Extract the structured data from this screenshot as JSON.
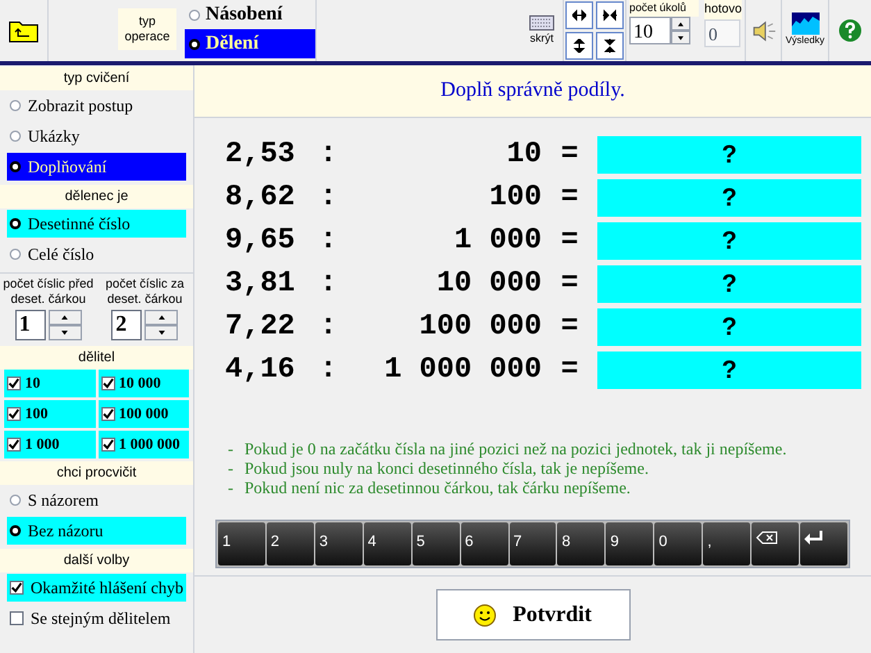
{
  "toolbar": {
    "operation_label": "typ operace",
    "operations": [
      {
        "label": "Násobení",
        "selected": false
      },
      {
        "label": "Dělení",
        "selected": true
      }
    ],
    "keyboard_label": "skrýt",
    "task_count": {
      "label": "počet úkolů",
      "value": "10"
    },
    "done": {
      "label": "hotovo",
      "value": "0",
      "disabled": true
    },
    "results_label": "Výsledky"
  },
  "sidebar": [
    {
      "title": "typ cvičení",
      "kind": "mode",
      "options": [
        {
          "label": "Zobrazit postup",
          "selected": false
        },
        {
          "label": "Ukázky",
          "selected": false
        },
        {
          "label": "Doplňování",
          "selected": true
        }
      ]
    },
    {
      "title": "dělenec je",
      "kind": "radio",
      "options": [
        {
          "label": "Desetinné číslo",
          "selected": true
        },
        {
          "label": "Celé číslo",
          "selected": false
        }
      ]
    },
    {
      "kind": "spinners",
      "spinners": [
        {
          "label": "počet číslic před deset. čárkou",
          "value": "1"
        },
        {
          "label": "počet číslic za deset. čárkou",
          "value": "2"
        }
      ]
    },
    {
      "title": "dělitel",
      "kind": "grid",
      "options": [
        {
          "label": "10",
          "checked": true
        },
        {
          "label": "10 000",
          "checked": true
        },
        {
          "label": "100",
          "checked": true
        },
        {
          "label": "100 000",
          "checked": true
        },
        {
          "label": "1 000",
          "checked": true
        },
        {
          "label": "1 000 000",
          "checked": true
        }
      ]
    },
    {
      "title": "chci procvičit",
      "kind": "radio",
      "options": [
        {
          "label": "S názorem",
          "selected": false
        },
        {
          "label": "Bez názoru",
          "selected": true
        }
      ]
    },
    {
      "title": "další volby",
      "kind": "checkbox",
      "options": [
        {
          "label": "Okamžité hlášení chyb",
          "checked": true
        },
        {
          "label": "Se stejným dělitelem",
          "checked": false
        }
      ]
    }
  ],
  "instruction": "Doplň správně podíly.",
  "rows": [
    {
      "dividend": "2,53",
      "op": ":",
      "divisor": "10",
      "eq": "=",
      "answer": "?"
    },
    {
      "dividend": "8,62",
      "op": ":",
      "divisor": "100",
      "eq": "=",
      "answer": "?"
    },
    {
      "dividend": "9,65",
      "op": ":",
      "divisor": "1 000",
      "eq": "=",
      "answer": "?"
    },
    {
      "dividend": "3,81",
      "op": ":",
      "divisor": "10 000",
      "eq": "=",
      "answer": "?"
    },
    {
      "dividend": "7,22",
      "op": ":",
      "divisor": "100 000",
      "eq": "=",
      "answer": "?"
    },
    {
      "dividend": "4,16",
      "op": ":",
      "divisor": "1 000 000",
      "eq": "=",
      "answer": "?"
    }
  ],
  "notes": [
    {
      "dash": "-",
      "text": "Pokud je 0 na začátku čísla na jiné pozici než na pozici jednotek, tak ji nepíšeme."
    },
    {
      "dash": "-",
      "text": "Pokud jsou nuly na konci desetinného čísla, tak je nepíšeme."
    },
    {
      "dash": "-",
      "text": "Pokud není nic za desetinnou čárkou, tak čárku nepíšeme."
    }
  ],
  "keypad": [
    {
      "kind": "char",
      "label": "1"
    },
    {
      "kind": "char",
      "label": "2"
    },
    {
      "kind": "char",
      "label": "3"
    },
    {
      "kind": "char",
      "label": "4"
    },
    {
      "kind": "char",
      "label": "5"
    },
    {
      "kind": "char",
      "label": "6"
    },
    {
      "kind": "char",
      "label": "7"
    },
    {
      "kind": "char",
      "label": "8"
    },
    {
      "kind": "char",
      "label": "9"
    },
    {
      "kind": "char",
      "label": "0"
    },
    {
      "kind": "char",
      "label": ","
    },
    {
      "kind": "backspace"
    },
    {
      "kind": "enter"
    }
  ],
  "confirm_label": "Potvrdit"
}
